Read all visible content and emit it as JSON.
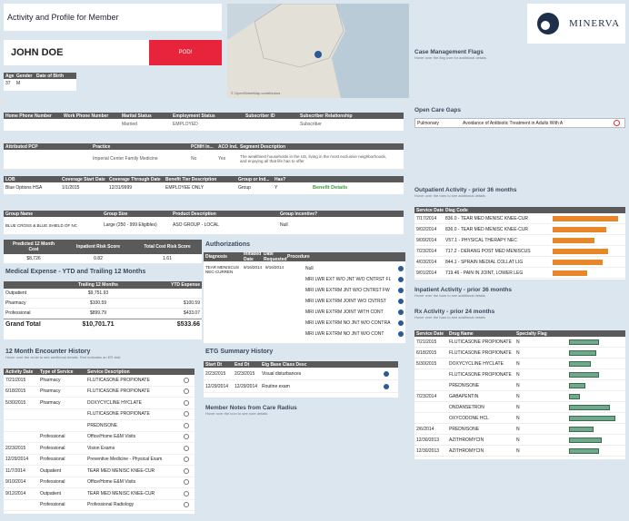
{
  "title": "Activity and Profile for Member",
  "member_name": "JOHN DOE",
  "pod_button": "POD!",
  "demographics": {
    "headers": [
      "Age",
      "Gender",
      "Date of Birth"
    ],
    "values": [
      "37",
      "M",
      ""
    ]
  },
  "map_credit": "© OpenStreetMap contributors",
  "logo_text": "MINERVA",
  "contact": {
    "headers": [
      "Home Phone Number",
      "Work Phone Number",
      "Marital Status",
      "Employment Status",
      "Subscriber ID",
      "Subscriber Relationship"
    ],
    "values": [
      "",
      "",
      "Married",
      "EMPLOYED",
      "",
      "Subscriber"
    ]
  },
  "pcp": {
    "headers": [
      "Attributed PCP",
      "Practice",
      "PCMH In...",
      "ACO Ind...",
      "Segment Description"
    ],
    "values": [
      "",
      "Imperial Center Family Medicine",
      "No",
      "Yes",
      "The wealthiest households in the US, living in the most exclusive neighborhoods, and enjoying all that life has to offer"
    ]
  },
  "coverage": {
    "headers": [
      "LOB",
      "Coverage Start Date",
      "Coverage Through Date",
      "Benefit Tier Description",
      "Group or Ind...",
      "Has?"
    ],
    "values": [
      "Blue Options HSA",
      "1/1/2015",
      "12/31/9999",
      "EMPLOYEE ONLY",
      "Group",
      "Y"
    ],
    "link": "Benefit Details"
  },
  "group": {
    "headers": [
      "Group Name",
      "Group Size",
      "Product Description",
      "Group Incentive?"
    ],
    "values": [
      "BLUE CROSS & BLUE SHIELD OF NC",
      "Large (250 - 999 Eligibles)",
      "ASO GROUP - LOCAL",
      "Null"
    ]
  },
  "risk": {
    "headers": [
      "Predicted 12 Month Cost",
      "Inpatient Risk Score",
      "Total Cost Risk Score"
    ],
    "values": [
      "$8,726",
      "0.82",
      "1.61"
    ]
  },
  "medical": {
    "title": "Medical Expense - YTD and Trailing 12 Months",
    "headers": [
      "",
      "Trailing 12 Months",
      "YTD Expense"
    ],
    "rows": [
      [
        "Outpatient",
        "$9,751.93",
        ""
      ],
      [
        "Pharmacy",
        "$100.59",
        "$100.59"
      ],
      [
        "Professional",
        "$899.79",
        "$433.07"
      ]
    ],
    "grand": [
      "Grand Total",
      "$10,701.71",
      "$533.66"
    ]
  },
  "encounter": {
    "title": "12 Month Encounter History",
    "hint": "Hover over the circle to see additional details. Red indicates an ER visit.",
    "headers": [
      "Activity Date",
      "Type of Service",
      "Service Description"
    ],
    "rows": [
      [
        "7/21/2015",
        "Pharmacy",
        "FLUTICASONE PROPIONATE"
      ],
      [
        "6/18/2015",
        "Pharmacy",
        "FLUTICASONE PROPIONATE"
      ],
      [
        "5/30/2015",
        "Pharmacy",
        "DOXYCYCLINE HYCLATE"
      ],
      [
        "",
        "",
        "FLUTICASONE PROPIONATE"
      ],
      [
        "",
        "",
        "PREDNISONE"
      ],
      [
        "",
        "Professional",
        "Office/Home E&M Visits"
      ],
      [
        "2/23/2015",
        "Professional",
        "Vision Exams"
      ],
      [
        "12/29/2014",
        "Professional",
        "Preventive Medicine - Physical Exam"
      ],
      [
        "11/7/2014",
        "Outpatient",
        "TEAR MED MENISC KNEE-CUR"
      ],
      [
        "9/10/2014",
        "Professional",
        "Office/Home E&M Visits"
      ],
      [
        "9/12/2014",
        "Outpatient",
        "TEAR MED MENISC KNEE-CUR"
      ],
      [
        "",
        "Professional",
        "Professional Radiology"
      ]
    ]
  },
  "authorizations": {
    "title": "Authorizations",
    "headers": [
      "Diagnosis",
      "Initiated Date",
      "Date Requested",
      "Procedure"
    ],
    "diag": "TEAR MENISCUS NEC-CURREN",
    "init": "9/16/2014",
    "req": "9/16/2014",
    "procs": [
      "Null",
      "MRI LWR EXT W/O JNT W/O CNTRST FL",
      "MRI LWR EXTRM JNT W/O CNTRST FW",
      "MRI LWR EXTRM JOINT W/O CNTRST",
      "MRI LWR EXTRM JOINT WITH CONT",
      "MRI LWR EXTRM NO JNT W/O CONTRA",
      "MRI LWR EXTRM NO JNT W/O CONT"
    ]
  },
  "etg": {
    "title": "ETG Summary History",
    "headers": [
      "Start Dt",
      "End Dt",
      "Etg Base Class Desc"
    ],
    "rows": [
      [
        "2/23/2015",
        "2/23/2015",
        "Visual disturbances"
      ],
      [
        "12/29/2014",
        "12/29/2014",
        "Routine exam"
      ]
    ]
  },
  "radius": {
    "title": "Member Notes from Care Radius",
    "hint": "Hover over the icon to see note details"
  },
  "flags": {
    "title": "Case Management Flags",
    "hint": "Hover over the flag icon for additional details"
  },
  "gaps": {
    "title": "Open Care Gaps",
    "cat": "Pulmonary",
    "desc": "Avoidance of Antibiotic Treatment in Adults With A"
  },
  "outpatient": {
    "title": "Outpatient Activity - prior 36 months",
    "hint": "Hover over the bars to see additional details",
    "headers": [
      "Service Date",
      "Diag Code"
    ],
    "rows": [
      [
        "7/17/2014",
        "836.0 - TEAR MED MENISC KNEE-CUR",
        0.95
      ],
      [
        "9/02/2014",
        "836.0 - TEAR MED MENISC KNEE-CUR",
        0.78
      ],
      [
        "9/09/2014",
        "V57.1 - PHYSICAL THERAPY NEC",
        0.6
      ],
      [
        "7/23/2014",
        "717.2 - DERANG POST MED MENISCUS",
        0.8
      ],
      [
        "4/03/2014",
        "844.1 - SPRAIN MEDIAL COLLAT LIG",
        0.72
      ],
      [
        "9/01/2014",
        "719.46 - PAIN IN JOINT, LOWER LEG",
        0.5
      ]
    ]
  },
  "inpatient": {
    "title": "Inpatient Activity - prior 36 months",
    "hint": "Hover over the bars to see additional details"
  },
  "rx": {
    "title": "Rx Activity - prior 24 months",
    "hint": "Hover over the bars to see additional details",
    "headers": [
      "Service Date",
      "Drug Name",
      "Specialty Flag"
    ],
    "rows": [
      [
        "7/21/2015",
        "FLUTICASONE PROPIONATE",
        "N",
        0.55
      ],
      [
        "6/18/2015",
        "FLUTICASONE PROPIONATE",
        "N",
        0.5
      ],
      [
        "5/30/2015",
        "DOXYCYCLINE HYCLATE",
        "N",
        0.4
      ],
      [
        "",
        "FLUTICASONE PROPIONATE",
        "N",
        0.55
      ],
      [
        "",
        "PREDNISONE",
        "N",
        0.3
      ],
      [
        "7/23/2014",
        "GABAPENTIN",
        "N",
        0.2
      ],
      [
        "",
        "ONDANSETRON",
        "N",
        0.75
      ],
      [
        "",
        "OXYCODONE HCL",
        "N",
        0.85
      ],
      [
        "2/6/2014",
        "PREDNISONE",
        "N",
        0.45
      ],
      [
        "12/30/2013",
        "AZITHROMYCIN",
        "N",
        0.6
      ],
      [
        "12/30/2013",
        "AZITHROMYCIN",
        "N",
        0.55
      ]
    ]
  }
}
